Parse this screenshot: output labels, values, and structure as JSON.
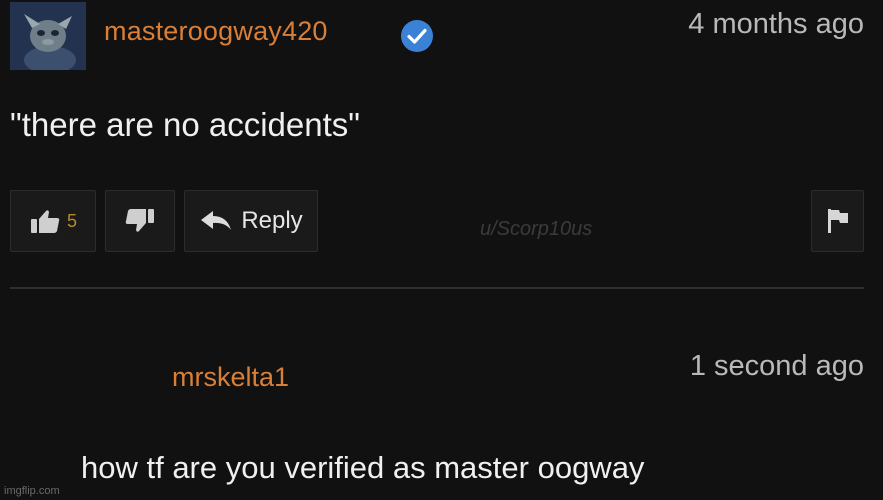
{
  "comments": [
    {
      "username": "masteroogway420",
      "verified": true,
      "timestamp": "4 months ago",
      "text": "\"there are no accidents\"",
      "like_count": "5",
      "reply_label": "Reply"
    },
    {
      "username": "mrskelta1",
      "timestamp": "1 second ago",
      "text": "how tf are you verified as master oogway"
    }
  ],
  "watermark": "u/Scorp10us",
  "credit": "imgflip.com",
  "icons": {
    "like": "thumbs-up-icon",
    "dislike": "thumbs-down-icon",
    "reply": "reply-arrow-icon",
    "flag": "flag-icon",
    "verified": "verified-check-icon"
  },
  "colors": {
    "username": "#d97f38",
    "verified": "#3b82d6",
    "like_count": "#b58b27",
    "background": "#111111"
  }
}
